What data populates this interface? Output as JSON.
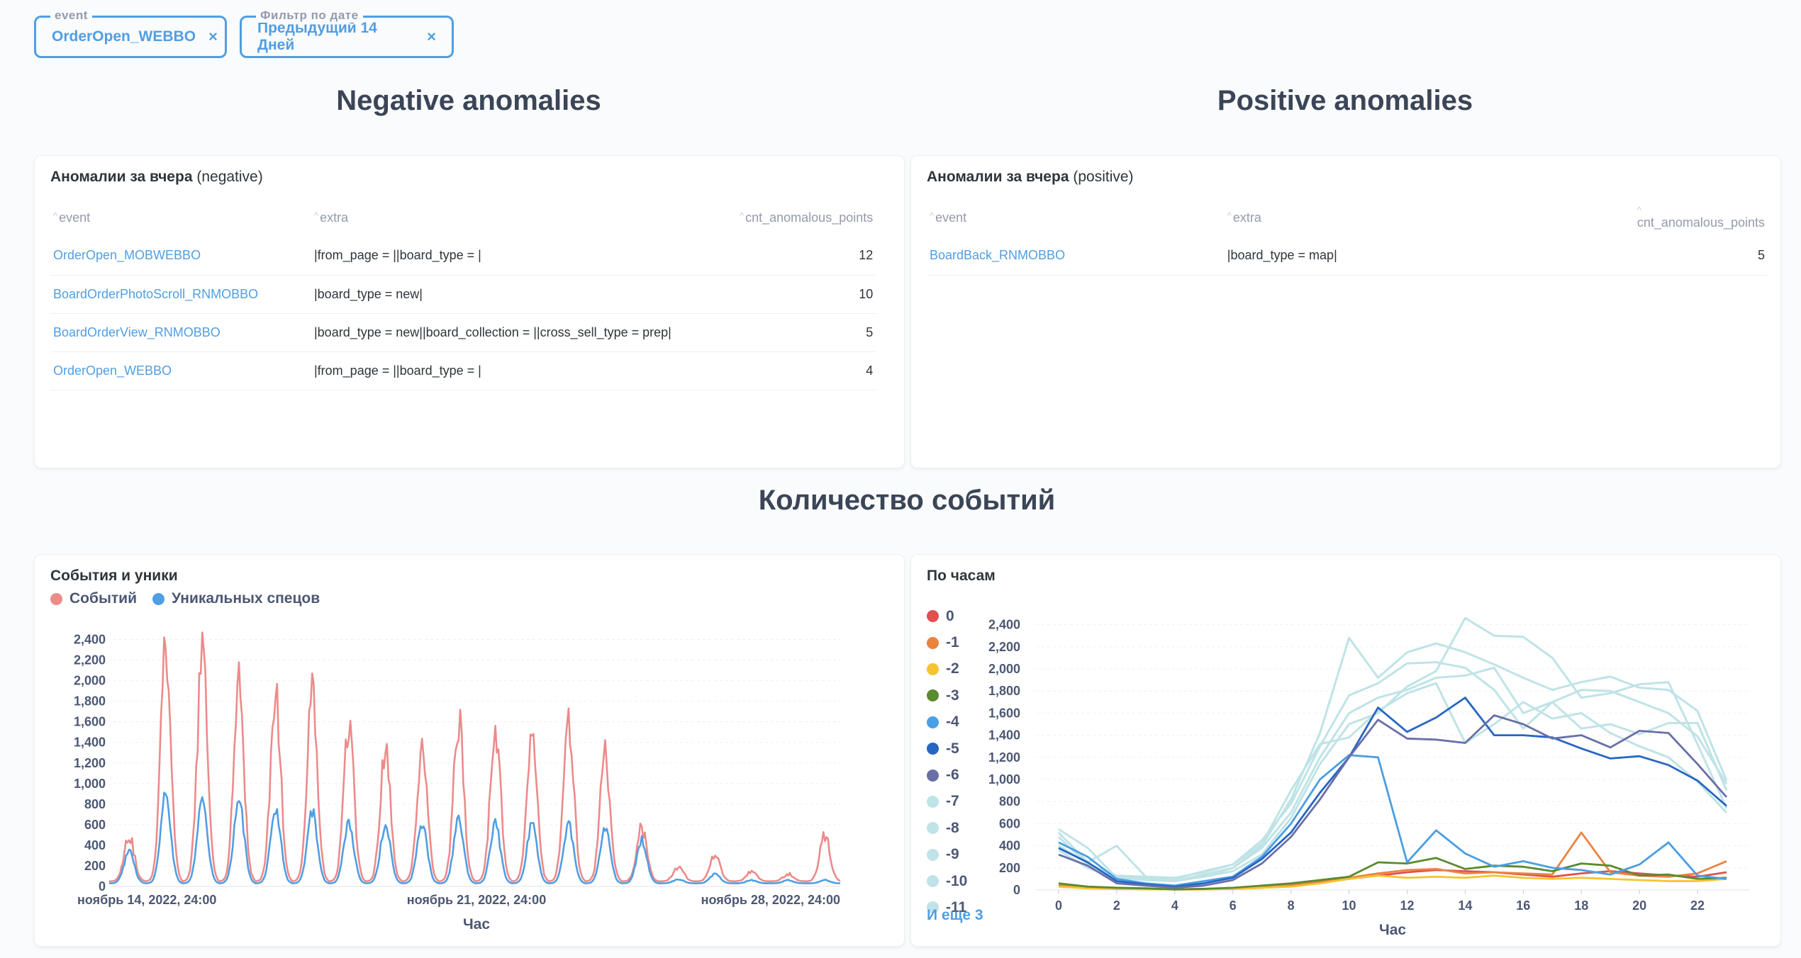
{
  "filters": [
    {
      "label": "event",
      "value": "OrderOpen_WEBBO",
      "remove": "×"
    },
    {
      "label": "Фильтр по дате",
      "value": "Предыдущий 14 Дней",
      "remove": "×"
    }
  ],
  "headings": {
    "negative": "Negative anomalies",
    "positive": "Positive anomalies",
    "events": "Количество событий"
  },
  "neg_table": {
    "title_bold": "Аномалии за вчера",
    "title_rest": "(negative)",
    "columns": [
      "event",
      "extra",
      "cnt_anomalous_points"
    ],
    "rows": [
      [
        "OrderOpen_MOBWEBBO",
        "|from_page = ||board_type = |",
        "12"
      ],
      [
        "BoardOrderPhotoScroll_RNMOBBO",
        "|board_type = new|",
        "10"
      ],
      [
        "BoardOrderView_RNMOBBO",
        "|board_type = new||board_collection = ||cross_sell_type = prep|",
        "5"
      ],
      [
        "OrderOpen_WEBBO",
        "|from_page = ||board_type = |",
        "4"
      ]
    ]
  },
  "pos_table": {
    "title_bold": "Аномалии за вчера",
    "title_rest": "(positive)",
    "columns": [
      "event",
      "extra",
      "cnt_anomalous_points"
    ],
    "rows": [
      [
        "BoardBack_RNMOBBO",
        "|board_type = map|",
        "5"
      ]
    ]
  },
  "left_chart": {
    "title": "События и уники",
    "legend": [
      {
        "name": "Событий",
        "color": "#ed8a8a"
      },
      {
        "name": "Уникальных спецов",
        "color": "#509ee3"
      }
    ],
    "y_ticks": [
      "0",
      "200",
      "400",
      "600",
      "800",
      "1,000",
      "1,200",
      "1,400",
      "1,600",
      "1,800",
      "2,000",
      "2,200",
      "2,400"
    ],
    "x_ticks": [
      "ноябрь 14, 2022, 24:00",
      "ноябрь 21, 2022, 24:00",
      "ноябрь 28, 2022, 24:00"
    ],
    "xlabel": "Час"
  },
  "right_chart": {
    "title": "По часам",
    "legend": [
      {
        "name": "0",
        "color": "#e05050"
      },
      {
        "name": "-1",
        "color": "#e9843f"
      },
      {
        "name": "-2",
        "color": "#f5c431"
      },
      {
        "name": "-3",
        "color": "#5b8a2e"
      },
      {
        "name": "-4",
        "color": "#4a9ee3"
      },
      {
        "name": "-5",
        "color": "#2666c2"
      },
      {
        "name": "-6",
        "color": "#6a6fa8"
      },
      {
        "name": "-7",
        "color": "#bfe3e6"
      },
      {
        "name": "-8",
        "color": "#bfe3e6"
      },
      {
        "name": "-9",
        "color": "#bfe3e6"
      },
      {
        "name": "-10",
        "color": "#bfe3e6"
      },
      {
        "name": "-11",
        "color": "#bfe3e6"
      }
    ],
    "more": "И еще 3",
    "y_ticks": [
      "0",
      "200",
      "400",
      "600",
      "800",
      "1,000",
      "1,200",
      "1,400",
      "1,600",
      "1,800",
      "2,000",
      "2,200",
      "2,400"
    ],
    "x_ticks": [
      "0",
      "2",
      "4",
      "6",
      "8",
      "10",
      "12",
      "14",
      "16",
      "18",
      "20",
      "22"
    ],
    "xlabel": "Час"
  },
  "chart_data": [
    {
      "type": "line",
      "title": "События и уники",
      "xlabel": "Час",
      "ylabel": "",
      "ylim": [
        0,
        2500
      ],
      "x_range": [
        "2022-11-14 24:00",
        "2022-11-29"
      ],
      "series": [
        {
          "name": "Событий",
          "color": "#ed8a8a",
          "daily_peaks": [
            500,
            2430,
            2250,
            1950,
            1880,
            1900,
            1560,
            1300,
            1380,
            1600,
            1550,
            1500,
            1650,
            1280,
            560,
            190,
            310,
            150,
            120,
            500
          ],
          "daily_base": 50
        },
        {
          "name": "Уникальных спецов",
          "color": "#509ee3",
          "daily_peaks": [
            340,
            880,
            820,
            850,
            770,
            720,
            620,
            590,
            600,
            640,
            610,
            600,
            600,
            560,
            450,
            70,
            120,
            60,
            60,
            60
          ],
          "daily_base": 30
        }
      ]
    },
    {
      "type": "line",
      "title": "По часам",
      "xlabel": "Час",
      "ylabel": "",
      "ylim": [
        0,
        2500
      ],
      "x": [
        0,
        1,
        2,
        3,
        4,
        5,
        6,
        7,
        8,
        9,
        10,
        11,
        12,
        13,
        14,
        15,
        16,
        17,
        18,
        19,
        20,
        21,
        22,
        23
      ],
      "series": [
        {
          "name": "0",
          "color": "#e05050",
          "values": [
            40,
            20,
            10,
            10,
            5,
            5,
            10,
            20,
            40,
            70,
            100,
            130,
            160,
            180,
            170,
            160,
            140,
            120,
            150,
            170,
            150,
            130,
            120,
            160
          ]
        },
        {
          "name": "-1",
          "color": "#e9843f",
          "values": [
            50,
            30,
            20,
            10,
            5,
            10,
            15,
            30,
            50,
            80,
            110,
            150,
            180,
            190,
            150,
            160,
            150,
            140,
            520,
            160,
            130,
            120,
            150,
            260
          ]
        },
        {
          "name": "-2",
          "color": "#f5c431",
          "values": [
            30,
            15,
            10,
            5,
            5,
            5,
            10,
            20,
            30,
            60,
            100,
            130,
            110,
            120,
            110,
            130,
            110,
            100,
            110,
            100,
            90,
            80,
            80,
            100
          ]
        },
        {
          "name": "-3",
          "color": "#5b8a2e",
          "values": [
            60,
            30,
            20,
            15,
            5,
            10,
            20,
            40,
            60,
            90,
            120,
            250,
            240,
            290,
            190,
            220,
            210,
            170,
            240,
            220,
            130,
            140,
            100,
            110
          ]
        },
        {
          "name": "-4",
          "color": "#4a9ee3",
          "values": [
            430,
            300,
            100,
            60,
            40,
            80,
            120,
            300,
            600,
            1000,
            1220,
            1200,
            250,
            540,
            330,
            210,
            260,
            200,
            180,
            140,
            230,
            430,
            130,
            100
          ]
        },
        {
          "name": "-5",
          "color": "#2666c2",
          "values": [
            380,
            250,
            80,
            50,
            30,
            60,
            110,
            280,
            520,
            880,
            1200,
            1650,
            1430,
            1560,
            1740,
            1400,
            1400,
            1380,
            1280,
            1190,
            1210,
            1130,
            990,
            760
          ]
        },
        {
          "name": "-6",
          "color": "#6a6fa8",
          "values": [
            320,
            220,
            60,
            40,
            20,
            40,
            90,
            240,
            480,
            820,
            1200,
            1540,
            1370,
            1360,
            1330,
            1580,
            1500,
            1370,
            1400,
            1290,
            1440,
            1420,
            1140,
            840
          ]
        },
        {
          "name": "-7",
          "color": "#bfe3e6",
          "values": [
            550,
            380,
            110,
            90,
            80,
            120,
            200,
            400,
            820,
            1420,
            2280,
            1920,
            2150,
            2230,
            2150,
            2040,
            1920,
            1810,
            1880,
            1930,
            1830,
            1810,
            1620,
            990
          ]
        },
        {
          "name": "-8",
          "color": "#bfe3e6",
          "values": [
            520,
            250,
            400,
            120,
            100,
            170,
            230,
            450,
            780,
            1300,
            1760,
            1870,
            2050,
            2060,
            2010,
            1810,
            1460,
            1700,
            1460,
            1500,
            1410,
            1510,
            1510,
            900
          ]
        },
        {
          "name": "-9",
          "color": "#bfe3e6",
          "values": [
            400,
            240,
            120,
            100,
            80,
            140,
            200,
            380,
            700,
            1200,
            1600,
            1740,
            1810,
            1920,
            1940,
            2010,
            1600,
            1700,
            1810,
            1800,
            1700,
            1600,
            1390,
            960
          ]
        },
        {
          "name": "-10",
          "color": "#bfe3e6",
          "values": [
            360,
            200,
            110,
            110,
            90,
            120,
            170,
            320,
            650,
            1140,
            1500,
            1600,
            1840,
            1980,
            2460,
            2300,
            2290,
            2100,
            1740,
            1780,
            1860,
            1880,
            1320,
            740
          ]
        },
        {
          "name": "-11",
          "color": "#bfe3e6",
          "values": [
            480,
            230,
            130,
            120,
            110,
            160,
            230,
            420,
            900,
            1320,
            1380,
            1620,
            1780,
            1870,
            1330,
            1500,
            1700,
            1550,
            1600,
            1420,
            1300,
            1200,
            980,
            700
          ]
        }
      ]
    }
  ]
}
